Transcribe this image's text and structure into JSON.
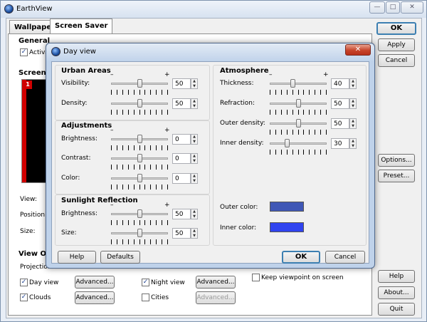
{
  "app": {
    "title": "EarthView",
    "caption_buttons": {
      "minimize": "—",
      "maximize": "□",
      "close": "✕"
    }
  },
  "tabs": [
    {
      "label": "Wallpaper",
      "active": false
    },
    {
      "label": "Screen Saver",
      "active": true
    }
  ],
  "main": {
    "general_title": "General",
    "activate_label": "Activat",
    "screen_area_title": "Screen A",
    "preview_badge": "1",
    "view_label": "View:",
    "position_label": "Position:",
    "size_label": "Size:",
    "view_options_title": "View Op",
    "projection_label": "Projection",
    "keep_viewpoint_label": "Keep viewpoint on screen",
    "options": [
      {
        "label": "Day view",
        "checked": true,
        "button": "Advanced..."
      },
      {
        "label": "Clouds",
        "checked": true,
        "button": "Advanced..."
      },
      {
        "label": "Night view",
        "checked": true,
        "button": "Advanced..."
      },
      {
        "label": "Cities",
        "checked": false,
        "button": "Advanced..."
      }
    ]
  },
  "right_buttons": {
    "ok": "OK",
    "apply": "Apply",
    "cancel": "Cancel",
    "options": "Options...",
    "preset": "Preset...",
    "help": "Help",
    "about": "About...",
    "quit": "Quit"
  },
  "dialog": {
    "title": "Day view",
    "close": "✕",
    "plus": "+",
    "minus": "–",
    "sections": {
      "urban": {
        "title": "Urban Areas",
        "rows": [
          {
            "label": "Visibility:",
            "value": "50",
            "fraction": 0.5
          },
          {
            "label": "Density:",
            "value": "50",
            "fraction": 0.5
          }
        ]
      },
      "adjustments": {
        "title": "Adjustments",
        "rows": [
          {
            "label": "Brightness:",
            "value": "0",
            "fraction": 0.5
          },
          {
            "label": "Contrast:",
            "value": "0",
            "fraction": 0.5
          },
          {
            "label": "Color:",
            "value": "0",
            "fraction": 0.5
          }
        ]
      },
      "sunlight": {
        "title": "Sunlight Reflection",
        "rows": [
          {
            "label": "Brightness:",
            "value": "50",
            "fraction": 0.5
          },
          {
            "label": "Size:",
            "value": "50",
            "fraction": 0.5
          }
        ]
      },
      "atmosphere": {
        "title": "Atmosphere",
        "rows": [
          {
            "label": "Thickness:",
            "value": "40",
            "fraction": 0.4
          },
          {
            "label": "Refraction:",
            "value": "50",
            "fraction": 0.5
          },
          {
            "label": "Outer density:",
            "value": "50",
            "fraction": 0.5
          },
          {
            "label": "Inner density:",
            "value": "30",
            "fraction": 0.3
          }
        ],
        "outer_color_label": "Outer color:",
        "inner_color_label": "Inner color:",
        "outer_color": "#3f57b6",
        "inner_color": "#2f43ef"
      }
    },
    "buttons": {
      "help": "Help",
      "defaults": "Defaults",
      "ok": "OK",
      "cancel": "Cancel"
    }
  }
}
